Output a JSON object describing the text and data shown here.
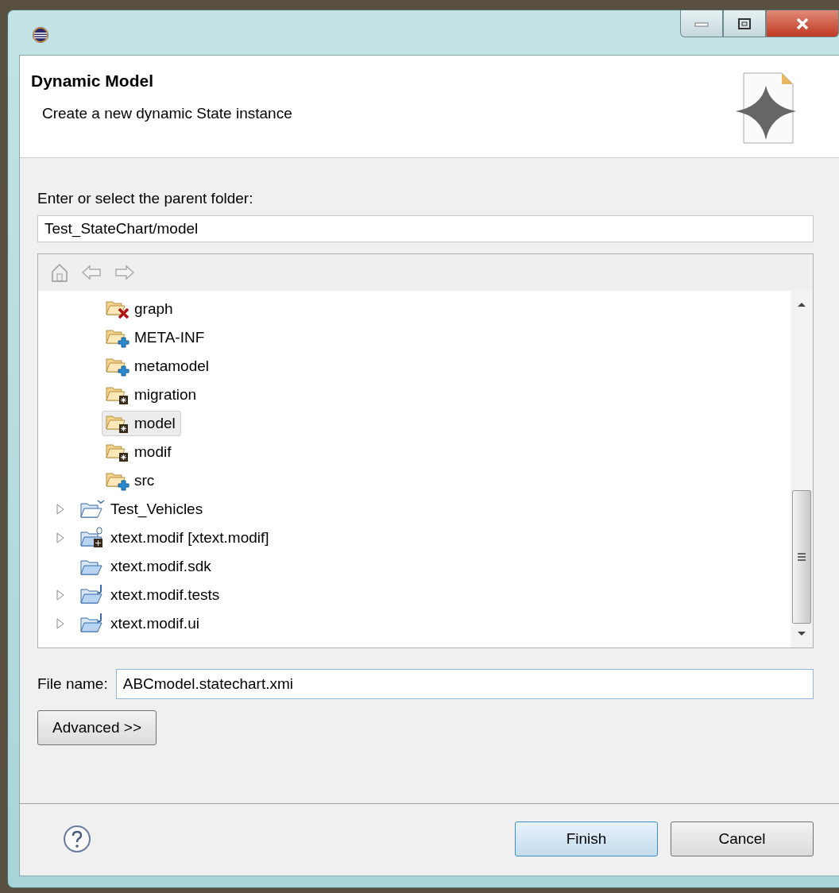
{
  "header": {
    "title": "Dynamic Model",
    "description": "Create a new dynamic State instance"
  },
  "folder_label": "Enter or select the parent folder:",
  "folder_field": {
    "value": "Test_StateChart/model"
  },
  "tree": {
    "continued_children": [
      {
        "label": "graph",
        "kind": "error",
        "selected": false
      },
      {
        "label": "META-INF",
        "kind": "source",
        "selected": false
      },
      {
        "label": "metamodel",
        "kind": "source",
        "selected": false
      },
      {
        "label": "migration",
        "kind": "resource",
        "selected": false
      },
      {
        "label": "model",
        "kind": "resource",
        "selected": true
      },
      {
        "label": "modif",
        "kind": "resource",
        "selected": false
      },
      {
        "label": "src",
        "kind": "source",
        "selected": false
      }
    ],
    "items": [
      {
        "label": "Test_Vehicles",
        "kind": "closed-project",
        "expandable": true,
        "selected": false
      },
      {
        "label": "xtext.modif [xtext.modif]",
        "kind": "plugin-project",
        "expandable": true,
        "selected": false
      },
      {
        "label": "xtext.modif.sdk",
        "kind": "project",
        "expandable": false,
        "selected": false
      },
      {
        "label": "xtext.modif.tests",
        "kind": "java-project",
        "expandable": true,
        "selected": false
      },
      {
        "label": "xtext.modif.ui",
        "kind": "java-project",
        "expandable": true,
        "selected": false
      }
    ]
  },
  "file_name": {
    "label": "File name:",
    "value": "ABCmodel.statechart.xmi"
  },
  "advanced_button": "Advanced >>",
  "buttons": [
    {
      "label": "Finish",
      "default": true
    },
    {
      "label": "Cancel",
      "default": false
    }
  ]
}
